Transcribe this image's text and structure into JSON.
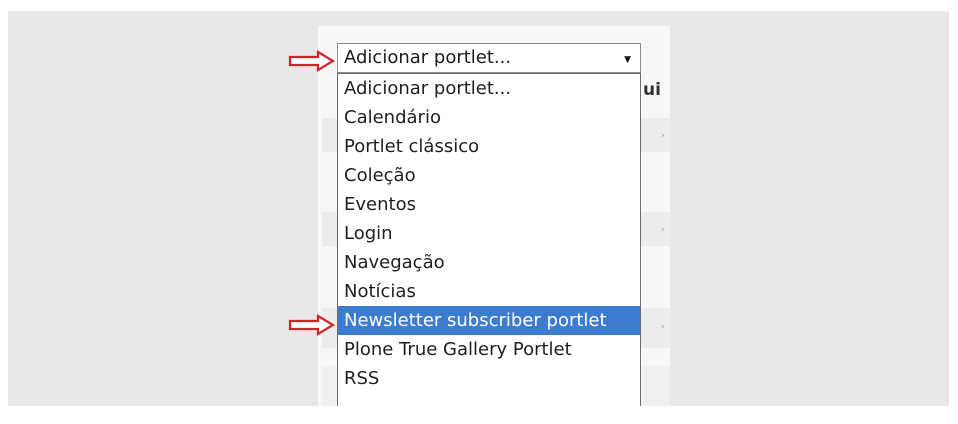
{
  "select": {
    "value": "Adicionar portlet..."
  },
  "dropdown": {
    "options": [
      "Adicionar portlet...",
      "Calendário",
      "Portlet clássico",
      "Coleção",
      "Eventos",
      "Login",
      "Navegação",
      "Notícias",
      "Newsletter subscriber portlet",
      "Plone True Gallery Portlet",
      "RSS"
    ],
    "selected_index": 8
  },
  "background": {
    "partial_heading": "ui"
  },
  "colors": {
    "highlight": "#3b7bd0",
    "annotation_arrow": "#d0242b"
  }
}
